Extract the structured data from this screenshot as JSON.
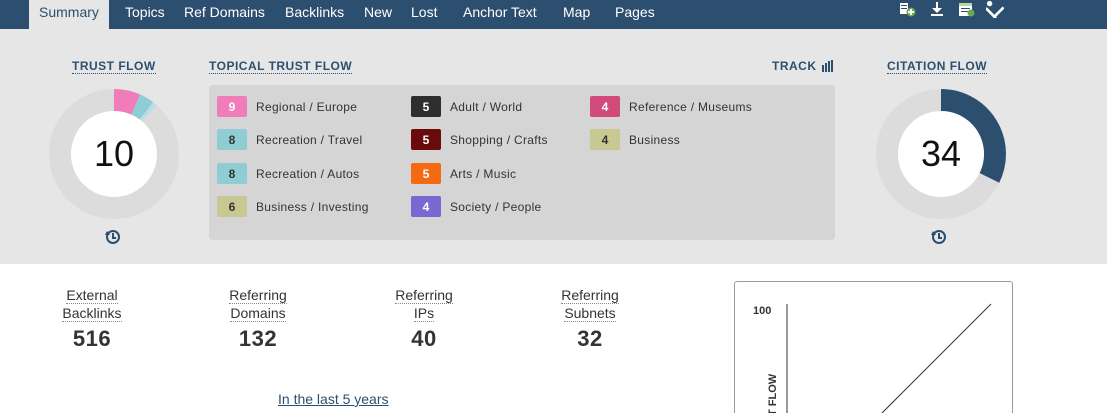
{
  "nav": {
    "tabs": [
      {
        "label": "Summary",
        "active": true
      },
      {
        "label": "Topics"
      },
      {
        "label": "Ref Domains"
      },
      {
        "label": "Backlinks"
      },
      {
        "label": "New"
      },
      {
        "label": "Lost"
      },
      {
        "label": "Anchor Text"
      },
      {
        "label": "Map"
      },
      {
        "label": "Pages"
      }
    ],
    "tools": [
      "add-report-icon",
      "download-icon",
      "export-icon",
      "tools-icon"
    ]
  },
  "trust_flow": {
    "title": "TRUST FLOW",
    "value": "10"
  },
  "citation_flow": {
    "title": "CITATION FLOW",
    "value": "34"
  },
  "topical": {
    "title": "TOPICAL TRUST FLOW",
    "track_label": "TRACK",
    "items": [
      {
        "score": "9",
        "label": "Regional / Europe",
        "color": "#f07cba",
        "text": "#ffffff"
      },
      {
        "score": "8",
        "label": "Recreation / Travel",
        "color": "#8ecdd3",
        "text": "#333333"
      },
      {
        "score": "8",
        "label": "Recreation / Autos",
        "color": "#8ecdd3",
        "text": "#333333"
      },
      {
        "score": "6",
        "label": "Business / Investing",
        "color": "#c7c892",
        "text": "#333333"
      },
      {
        "score": "5",
        "label": "Adult / World",
        "color": "#2e2e2e",
        "text": "#ffffff"
      },
      {
        "score": "5",
        "label": "Shopping / Crafts",
        "color": "#6b0a0a",
        "text": "#ffffff"
      },
      {
        "score": "5",
        "label": "Arts / Music",
        "color": "#f46a12",
        "text": "#ffffff"
      },
      {
        "score": "4",
        "label": "Society / People",
        "color": "#7b67d0",
        "text": "#ffffff"
      },
      {
        "score": "4",
        "label": "Reference / Museums",
        "color": "#d04a7a",
        "text": "#ffffff"
      },
      {
        "score": "4",
        "label": "Business",
        "color": "#c7c892",
        "text": "#333333"
      }
    ]
  },
  "stats": [
    {
      "line1": "External",
      "line2": "Backlinks",
      "value": "516"
    },
    {
      "line1": "Referring",
      "line2": "Domains",
      "value": "132"
    },
    {
      "line1": "Referring",
      "line2": "IPs",
      "value": "40"
    },
    {
      "line1": "Referring",
      "line2": "Subnets",
      "value": "32"
    }
  ],
  "period_link": "In the last 5 years",
  "mini_chart": {
    "y_max_label": "100",
    "axis_label": "T FLOW"
  },
  "colors": {
    "nav_bg": "#2d4f6f",
    "band_bg": "#e6e6e6",
    "citation_arc": "#2d4f6f"
  }
}
